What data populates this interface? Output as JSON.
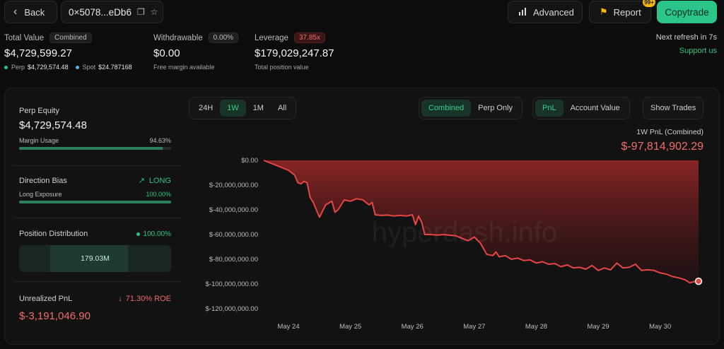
{
  "topbar": {
    "back_label": "Back",
    "address": "0×5078...eDb6",
    "advanced_label": "Advanced",
    "report_label": "Report",
    "report_badge": "99+",
    "copytrade_label": "Copytrade"
  },
  "stats": {
    "total_value": {
      "label": "Total Value",
      "tag": "Combined",
      "value": "$4,729,599.27",
      "perp_label": "Perp",
      "perp_value": "$4,729,574.48",
      "spot_label": "Spot",
      "spot_value": "$24.787168"
    },
    "withdrawable": {
      "label": "Withdrawable",
      "tag": "0.00%",
      "value": "$0.00",
      "sub": "Free margin available"
    },
    "leverage": {
      "label": "Leverage",
      "tag": "37.85x",
      "value": "$179,029,247.87",
      "sub": "Total position value"
    },
    "refresh": "Next refresh in 7s",
    "support": "Support us"
  },
  "sidebar": {
    "perp_equity": {
      "title": "Perp Equity",
      "value": "$4,729,574.48",
      "margin_label": "Margin Usage",
      "margin_value": "94.63%",
      "margin_fraction": 0.9463
    },
    "direction": {
      "title": "Direction Bias",
      "bias": "LONG",
      "exposure_label": "Long Exposure",
      "exposure_value": "100.00%",
      "exposure_fraction": 1.0
    },
    "distribution": {
      "title": "Position Distribution",
      "pct": "100.00%",
      "box_value": "179.03M"
    },
    "unrealized": {
      "title": "Unrealized PnL",
      "roe": "71.30% ROE",
      "value": "$-3,191,046.90"
    }
  },
  "controls": {
    "ranges": [
      "24H",
      "1W",
      "1M",
      "All"
    ],
    "active_range": "1W",
    "views": [
      "Combined",
      "Perp Only"
    ],
    "active_view": "Combined",
    "metrics": [
      "PnL",
      "Account Value"
    ],
    "active_metric": "PnL",
    "show_trades": "Show Trades"
  },
  "colors": {
    "accent": "#2bc58a",
    "negative": "#f26b6b",
    "line": "#e84545"
  },
  "chart_data": {
    "type": "area",
    "title": "1W PnL (Combined)",
    "headline_value": "$-97,814,902.29",
    "watermark": "hyperdash.info",
    "y_ticks": [
      "$0.00",
      "$-20,000,000.00",
      "$-40,000,000.00",
      "$-60,000,000.00",
      "$-80,000,000.00",
      "$-100,000,000.00",
      "$-120,000,000.00"
    ],
    "x_ticks": [
      "May 24",
      "May 25",
      "May 26",
      "May 27",
      "May 28",
      "May 29",
      "May 30"
    ],
    "ylim": [
      -120000000,
      0
    ],
    "x_range": [
      23.6,
      30.7
    ],
    "series": [
      {
        "x": [
          23.6,
          23.8,
          23.9,
          24.0,
          24.1,
          24.15,
          24.2,
          24.25,
          24.3,
          24.35,
          24.4,
          24.5,
          24.6,
          24.7,
          24.75,
          24.8,
          24.9,
          25.0,
          25.1,
          25.2,
          25.3,
          25.35,
          25.4,
          25.5,
          25.6,
          25.7,
          25.8,
          25.9,
          26.0,
          26.05,
          26.1,
          26.15,
          26.2,
          26.3,
          26.4,
          26.5,
          26.6,
          26.7,
          26.8,
          26.9,
          27.0,
          27.1,
          27.2,
          27.3,
          27.35,
          27.4,
          27.5,
          27.6,
          27.7,
          27.8,
          27.9,
          28.0,
          28.1,
          28.2,
          28.3,
          28.4,
          28.5,
          28.6,
          28.7,
          28.8,
          28.9,
          29.0,
          29.1,
          29.2,
          29.3,
          29.4,
          29.5,
          29.6,
          29.7,
          29.8,
          29.9,
          30.0,
          30.1,
          30.2,
          30.3,
          30.4,
          30.48,
          30.55,
          30.62
        ],
        "y": [
          0,
          -4000000,
          -6000000,
          -8000000,
          -12000000,
          -18000000,
          -19000000,
          -17000000,
          -18000000,
          -30000000,
          -34000000,
          -46000000,
          -36000000,
          -33000000,
          -42000000,
          -40000000,
          -32000000,
          -33000000,
          -31000000,
          -32000000,
          -36000000,
          -34000000,
          -44000000,
          -44500000,
          -44200000,
          -45000000,
          -44500000,
          -45000000,
          -44000000,
          -52000000,
          -45000000,
          -50000000,
          -60000000,
          -60000000,
          -60500000,
          -60000000,
          -60500000,
          -61000000,
          -63000000,
          -65000000,
          -62000000,
          -67000000,
          -76000000,
          -77000000,
          -74000000,
          -78000000,
          -77000000,
          -80000000,
          -79000000,
          -81000000,
          -80500000,
          -83000000,
          -82000000,
          -84000000,
          -83500000,
          -86000000,
          -84500000,
          -87000000,
          -86500000,
          -88000000,
          -85000000,
          -89000000,
          -87000000,
          -88500000,
          -83000000,
          -87000000,
          -86500000,
          -84000000,
          -89000000,
          -88500000,
          -89000000,
          -91000000,
          -92000000,
          -94000000,
          -95000000,
          -96500000,
          -99000000,
          -98000000,
          -97800000
        ]
      }
    ]
  }
}
